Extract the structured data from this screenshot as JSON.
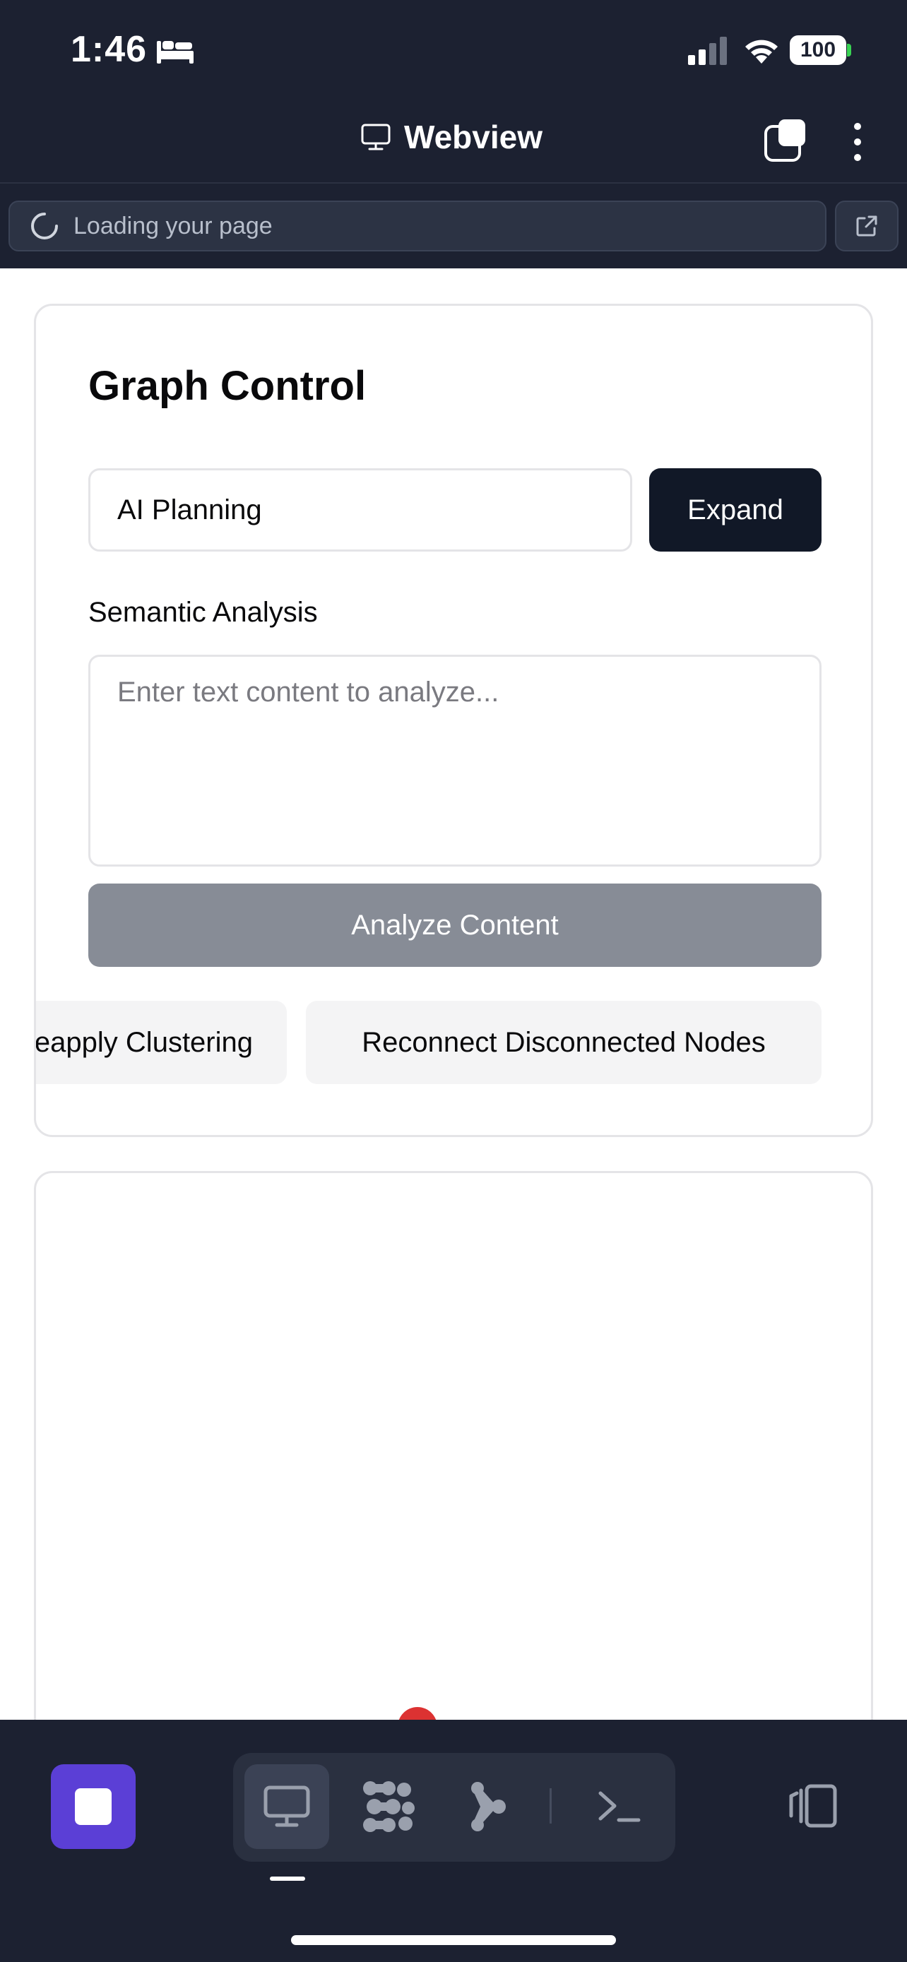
{
  "status_bar": {
    "time": "1:46",
    "battery": "100",
    "icons": [
      "sleep-icon",
      "signal-icon",
      "wifi-icon",
      "battery-icon"
    ]
  },
  "nav": {
    "title": "Webview",
    "title_icon": "monitor-icon",
    "right_icons": [
      "tabs-icon",
      "more-vertical-icon"
    ]
  },
  "url_bar": {
    "text": "Loading your page",
    "icons": [
      "loading-spinner-icon",
      "open-external-icon"
    ]
  },
  "graph_control": {
    "title": "Graph Control",
    "topic_input_value": "AI Planning",
    "expand_label": "Expand",
    "semantic_label": "Semantic Analysis",
    "analyze_placeholder": "Enter text content to analyze...",
    "analyze_button": "Analyze Content",
    "reapply_button": "Reapply Clustering",
    "reconnect_button": "Reconnect Disconnected Nodes"
  },
  "toolbar": {
    "items": [
      "stop-icon",
      "monitor-icon",
      "cluster-icon",
      "branch-icon",
      "terminal-icon",
      "device-switch-icon"
    ],
    "active": "monitor-icon"
  },
  "colors": {
    "chrome_bg": "#1c2131",
    "primary_button": "#111827",
    "disabled_button": "#878c96",
    "accent": "#5b3fd6",
    "node": "#dc3232"
  }
}
